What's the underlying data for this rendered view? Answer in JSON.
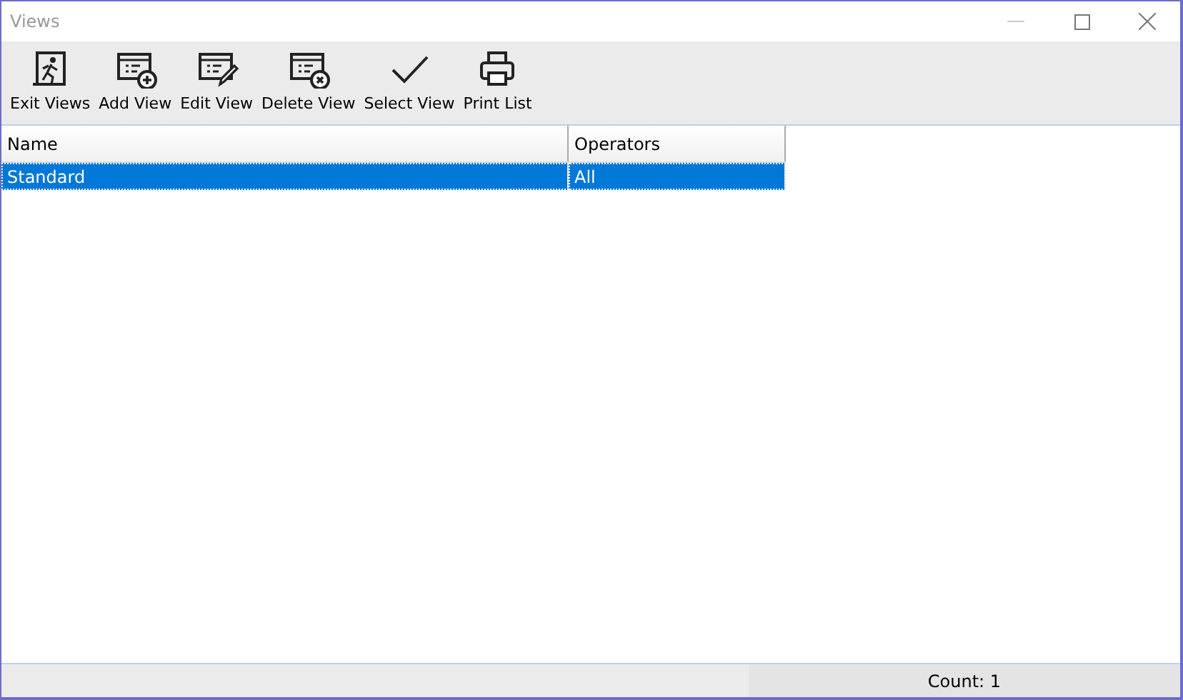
{
  "window": {
    "title": "Views"
  },
  "toolbar": [
    {
      "kind": "exit",
      "label": "Exit Views"
    },
    {
      "kind": "add",
      "label": "Add View"
    },
    {
      "kind": "edit",
      "label": "Edit View"
    },
    {
      "kind": "delete",
      "label": "Delete View"
    },
    {
      "kind": "select",
      "label": "Select View"
    },
    {
      "kind": "print",
      "label": "Print List"
    }
  ],
  "table": {
    "columns": [
      "Name",
      "Operators"
    ],
    "rows": [
      {
        "cells": [
          "Standard",
          "All"
        ],
        "selected": true
      }
    ]
  },
  "status_bar": {
    "count": "Count: 1"
  }
}
